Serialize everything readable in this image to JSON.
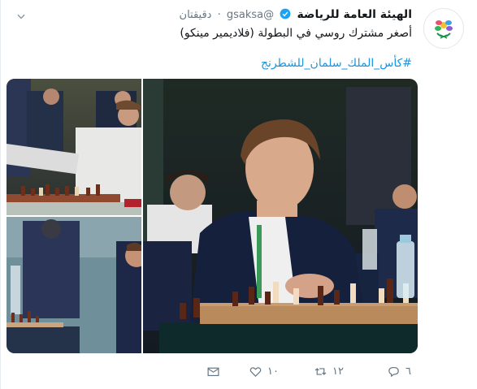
{
  "account": {
    "display_name": "الهيئة العامة للرياضة",
    "handle": "@gsaksa",
    "separator": "·",
    "time": "دقيقتان"
  },
  "tweet": {
    "text": "أصغر مشترك روسي في البطولة (فلاديمير مينكو)",
    "hashtag": "#كأس_الملك_سلمان_للشطرنج"
  },
  "actions": {
    "replies": "٦",
    "retweets": "١٢",
    "likes": "١٠"
  },
  "icons": {
    "avatar": "ministry-logo",
    "verified": "verified-badge-icon",
    "more": "chevron-down-icon",
    "reply": "reply-icon",
    "retweet": "retweet-icon",
    "like": "heart-icon",
    "dm": "envelope-icon"
  },
  "colors": {
    "link": "#1b95e0",
    "verified": "#1da1f2",
    "muted": "#657786"
  }
}
